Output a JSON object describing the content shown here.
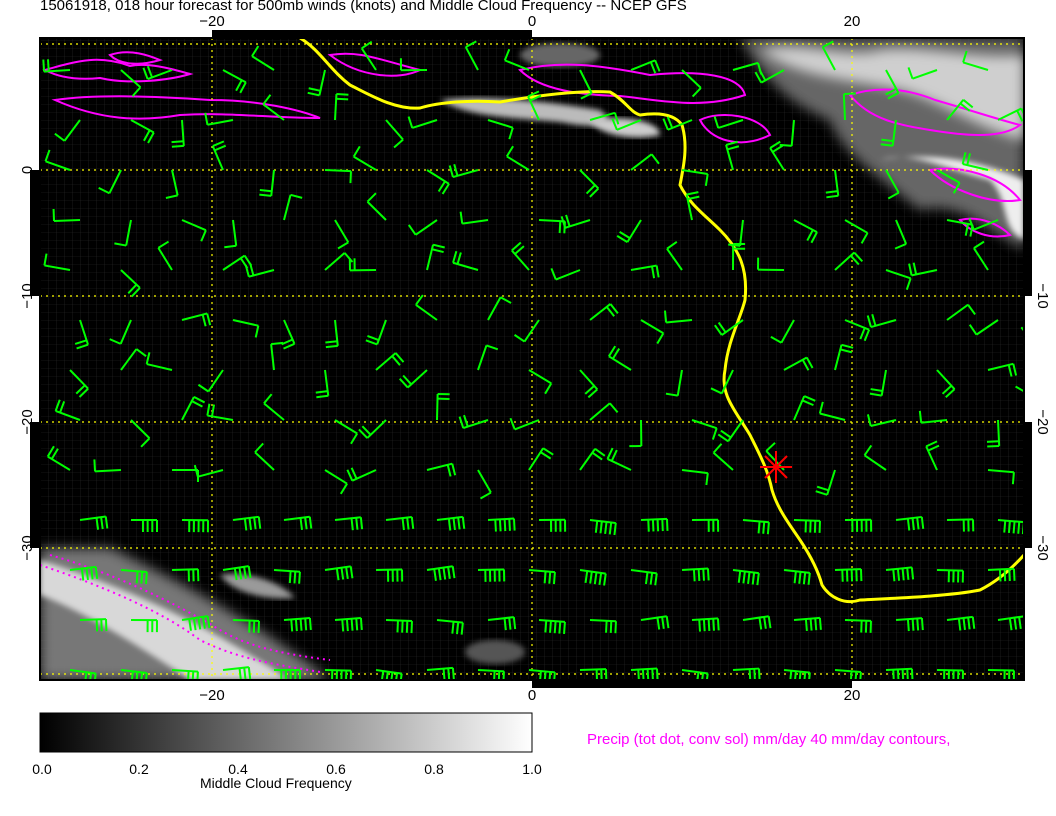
{
  "title": "15061918, 018 hour forecast for 500mb winds (knots) and Middle Cloud Frequency -- NCEP GFS",
  "map": {
    "lon_range": [
      -31,
      31
    ],
    "lat_range": [
      -41,
      10
    ],
    "lon_ticks": [
      -20,
      0,
      20
    ],
    "lat_ticks": [
      0,
      -10,
      -20,
      -30
    ],
    "lon_tick_labels": [
      "−20",
      "0",
      "20"
    ],
    "lat_tick_labels": [
      "0",
      "−10",
      "−20",
      "−30"
    ],
    "grid_color": "#ffff00",
    "coast_color": "#ffff00",
    "wind_barb_color": "#00ff00",
    "precip_color": "#ff00ff",
    "station_marker_color": "#ff0000",
    "station_marker_lonlat": [
      15.3,
      -23.5
    ],
    "grid": true
  },
  "colorbar": {
    "ticks": [
      "0.0",
      "0.2",
      "0.4",
      "0.6",
      "0.8",
      "1.0"
    ],
    "label": "Middle Cloud Frequency",
    "min_color": "#000000",
    "max_color": "#ffffff"
  },
  "precip_note": "Precip (tot dot, conv sol) mm/day 40 mm/day contours,"
}
